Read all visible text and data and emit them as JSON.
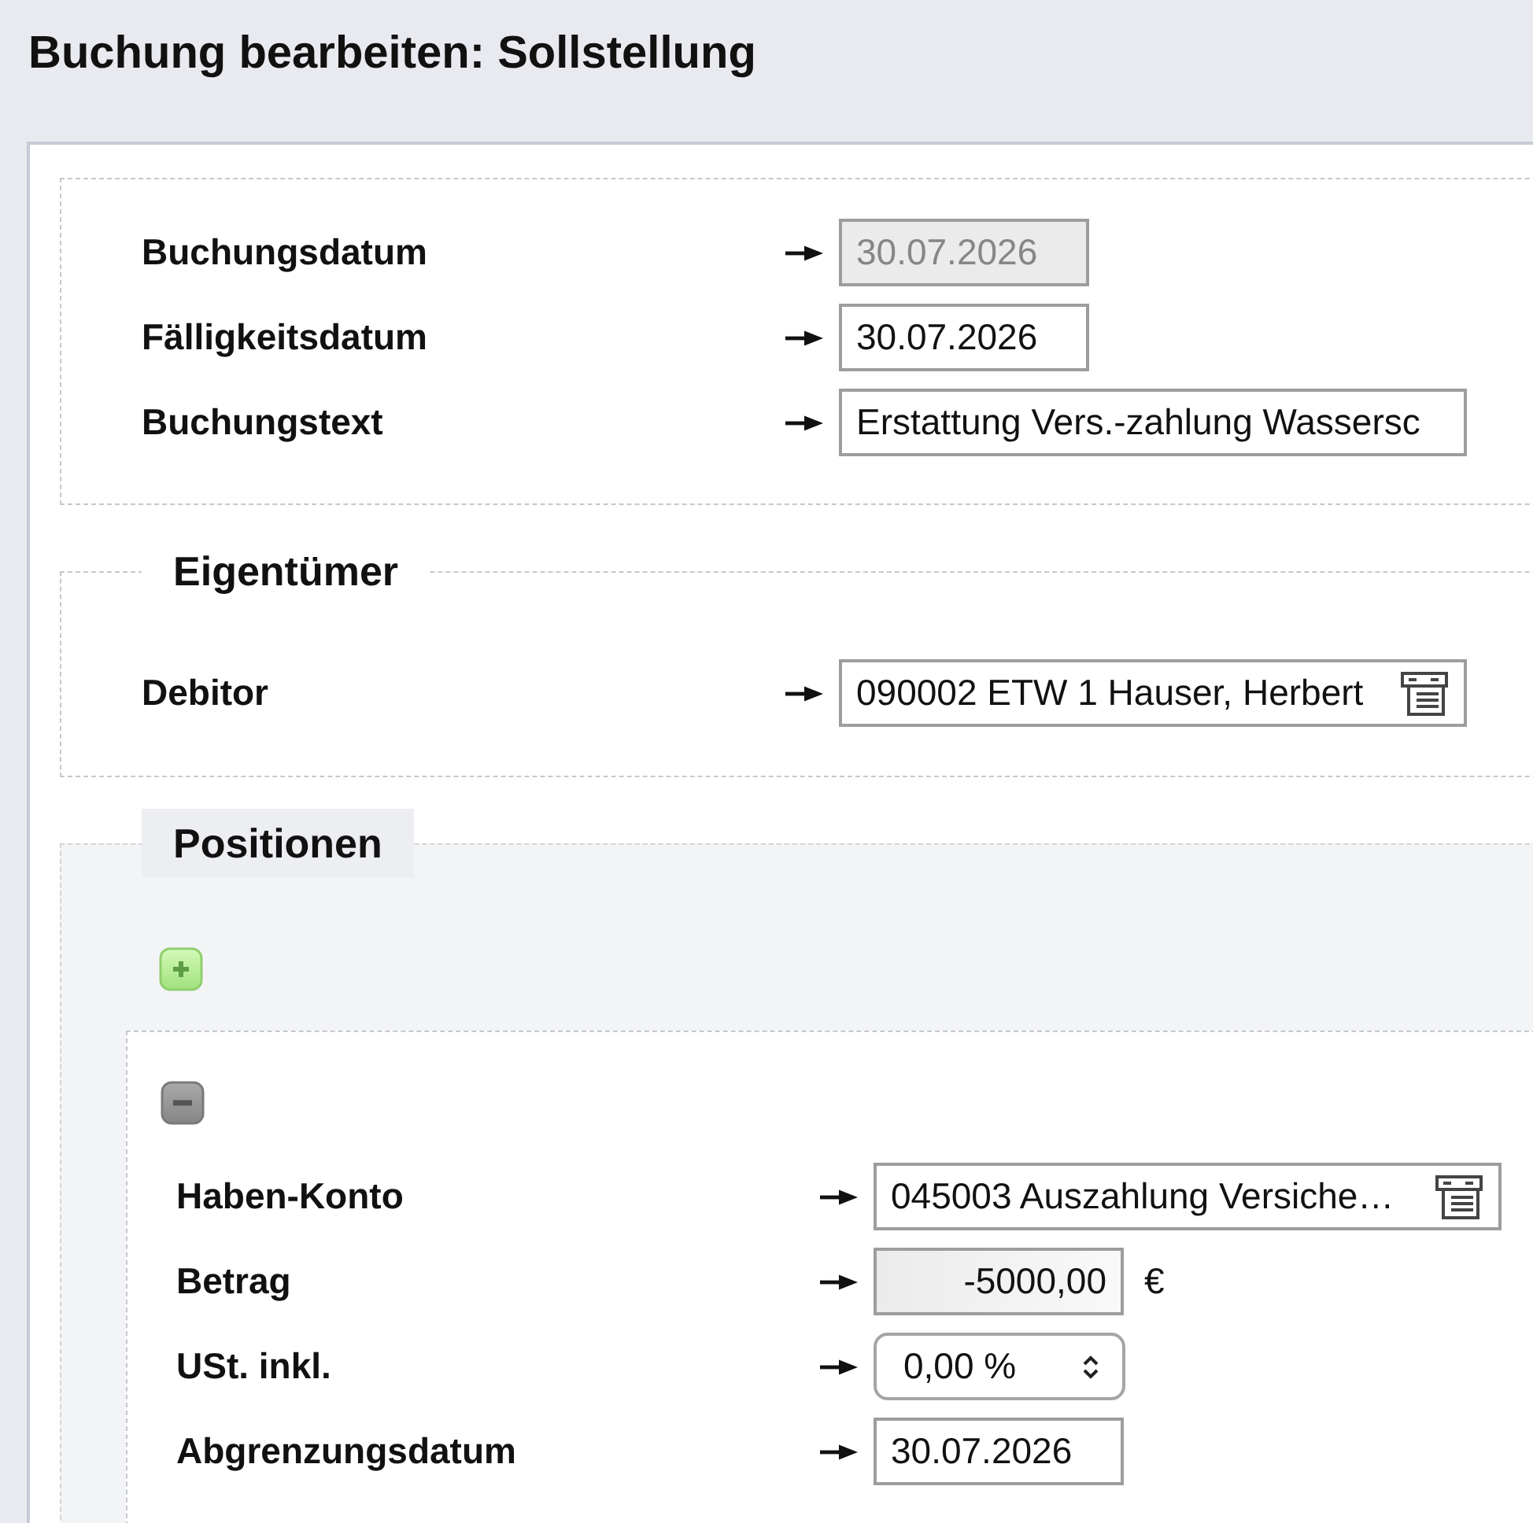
{
  "title": "Buchung bearbeiten: Sollstellung",
  "header_fields": [
    {
      "label": "Buchungsdatum",
      "kind": "date",
      "value": "30.07.2026",
      "disabled": true
    },
    {
      "label": "Fälligkeitsdatum",
      "kind": "date",
      "value": "30.07.2026",
      "disabled": false
    },
    {
      "label": "Buchungstext",
      "kind": "text",
      "value": "Erstattung Vers.-zahlung Wassersc",
      "disabled": false
    }
  ],
  "owner": {
    "legend": "Eigentümer",
    "fields": [
      {
        "label": "Debitor",
        "kind": "lookup",
        "value": "090002 ETW 1 Hauser, Herbert",
        "disabled": false
      }
    ]
  },
  "positions": {
    "legend": "Positionen",
    "items": [
      {
        "fields": [
          {
            "label": "Haben-Konto",
            "kind": "lookup",
            "value": "045003 Auszahlung Versiche…",
            "disabled": false
          },
          {
            "label": "Betrag",
            "kind": "amount",
            "value": "-5000,00",
            "unit": "€",
            "disabled": false
          },
          {
            "label": "USt. inkl.",
            "kind": "select",
            "value": "0,00 %",
            "disabled": false
          },
          {
            "label": "Abgrenzungsdatum",
            "kind": "date",
            "value": "30.07.2026",
            "disabled": false
          }
        ]
      }
    ]
  }
}
